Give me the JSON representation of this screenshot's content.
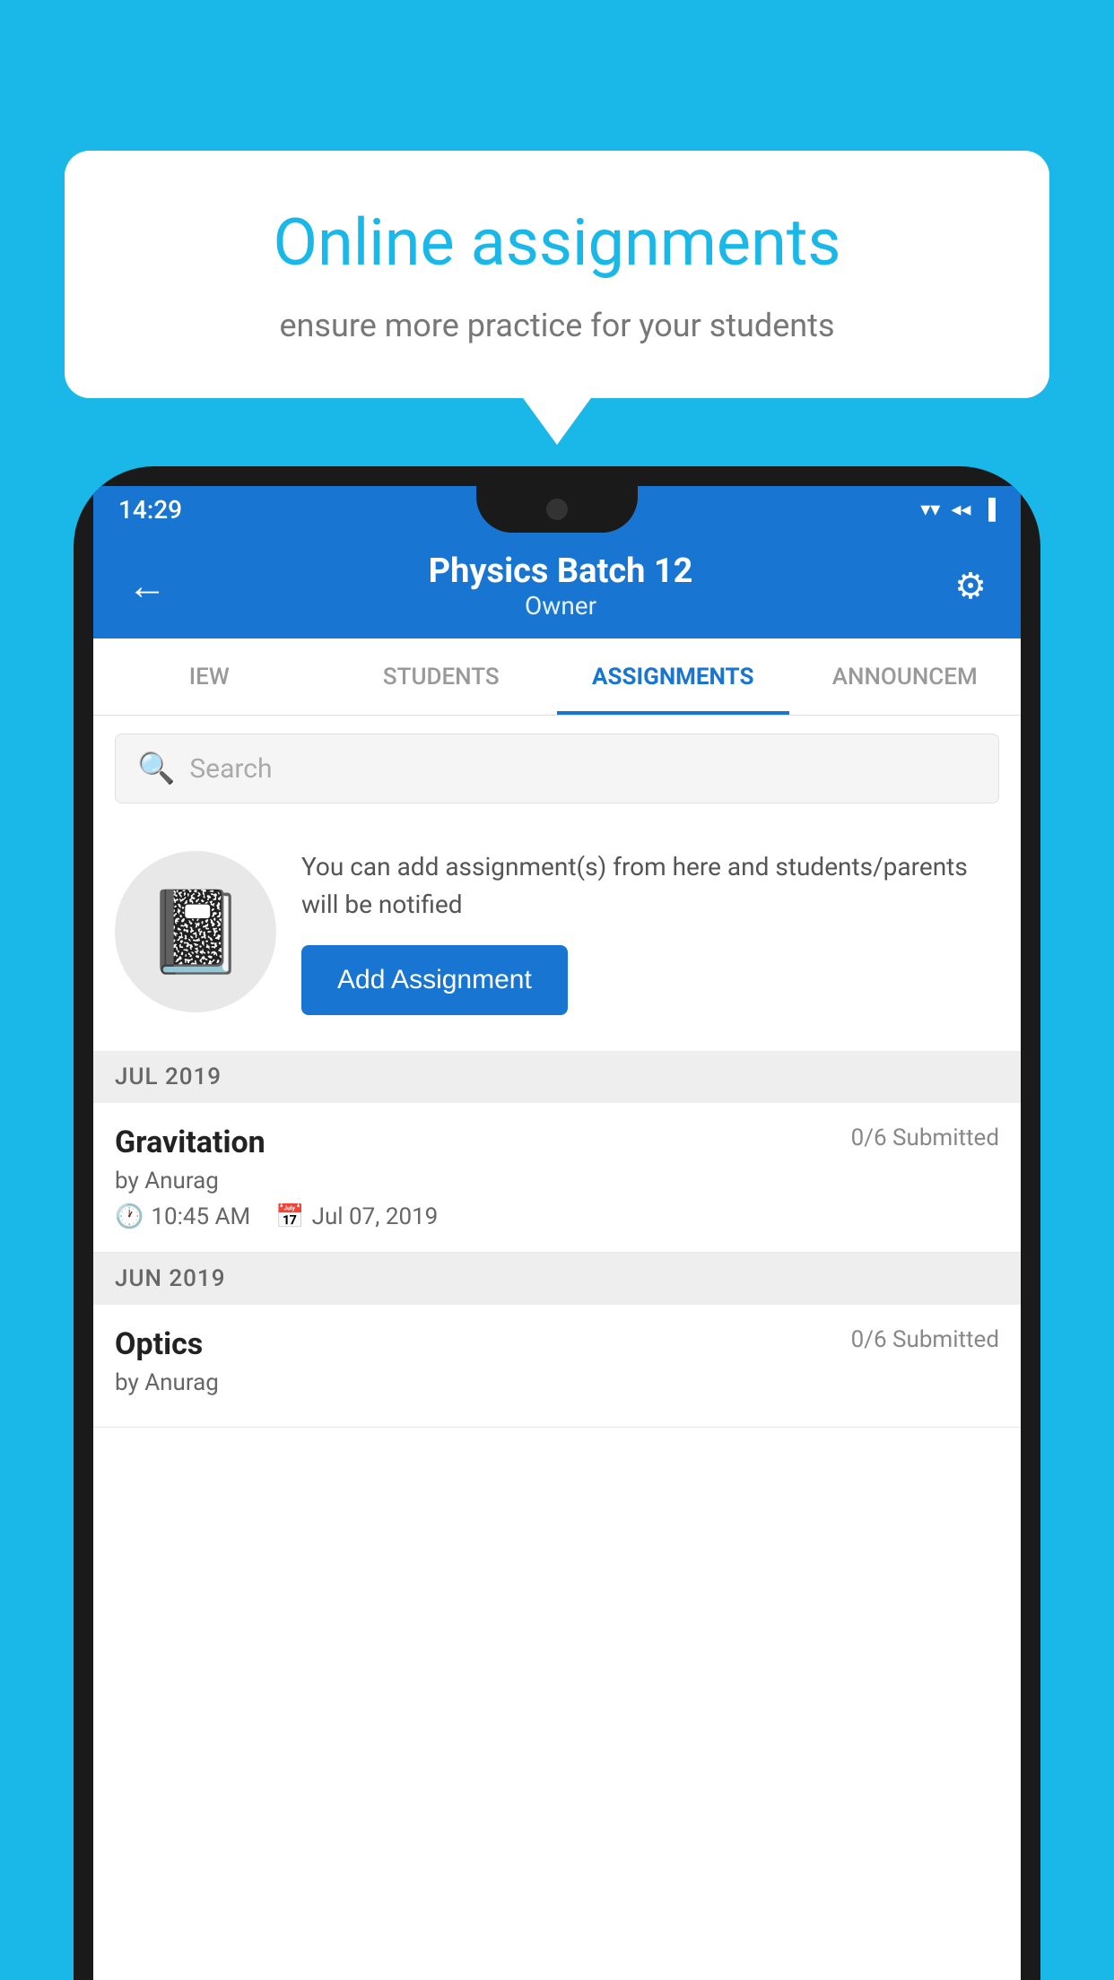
{
  "background_color": "#1ab8e8",
  "speech_bubble": {
    "title": "Online assignments",
    "subtitle": "ensure more practice for your students"
  },
  "status_bar": {
    "time": "14:29",
    "wifi_icon": "▼",
    "signal_icon": "▲",
    "battery_icon": "▌"
  },
  "app_bar": {
    "title": "Physics Batch 12",
    "subtitle": "Owner",
    "back_icon": "←",
    "settings_icon": "⚙"
  },
  "tabs": [
    {
      "label": "IEW",
      "active": false
    },
    {
      "label": "STUDENTS",
      "active": false
    },
    {
      "label": "ASSIGNMENTS",
      "active": true
    },
    {
      "label": "ANNOUNCЕМ",
      "active": false
    }
  ],
  "search": {
    "placeholder": "Search"
  },
  "empty_state": {
    "description": "You can add assignment(s) from here and students/parents will be notified",
    "button_label": "Add Assignment"
  },
  "assignments": {
    "sections": [
      {
        "label": "JUL 2019",
        "items": [
          {
            "name": "Gravitation",
            "submitted": "0/6 Submitted",
            "author": "by Anurag",
            "time": "10:45 AM",
            "date": "Jul 07, 2019"
          }
        ]
      },
      {
        "label": "JUN 2019",
        "items": [
          {
            "name": "Optics",
            "submitted": "0/6 Submitted",
            "author": "by Anurag",
            "time": "",
            "date": ""
          }
        ]
      }
    ]
  }
}
